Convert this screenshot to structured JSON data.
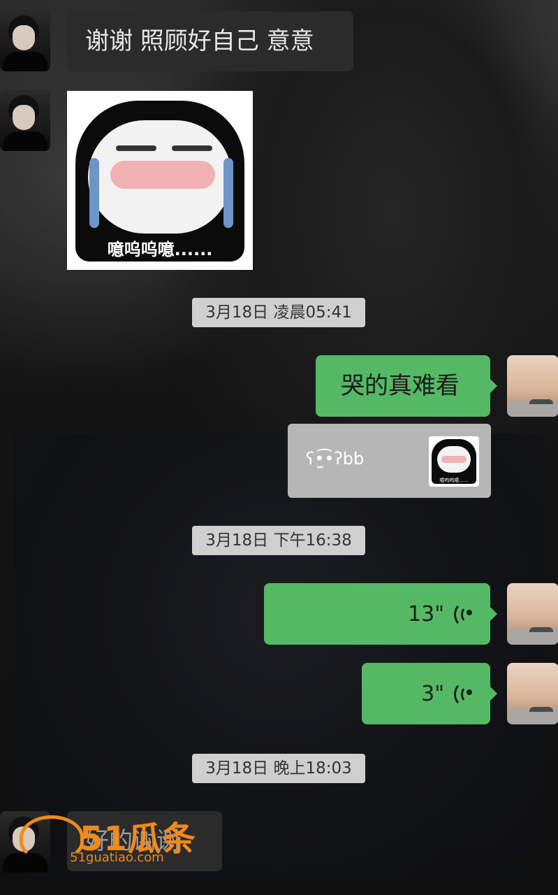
{
  "messages": {
    "m1": {
      "text": "谢谢 照顾好自己 意意"
    },
    "m2": {
      "meme_caption": "噫呜呜噫......"
    },
    "ts1": "3月18日 凌晨05:41",
    "m3": {
      "text": "哭的真难看"
    },
    "m4": {
      "quote_text": "ʕ•̫͡•ʔbb",
      "meme_caption": "噫呜呜噫......"
    },
    "ts2": "3月18日 下午16:38",
    "m5": {
      "voice_duration": "13\""
    },
    "m6": {
      "voice_duration": "3\""
    },
    "ts3": "3月18日 晚上18:03",
    "m7": {
      "text": "好的谢谢"
    }
  },
  "watermark": {
    "brand": "51瓜条",
    "site": "51guatiao.com"
  },
  "colors": {
    "outgoing_bubble": "#55b865",
    "incoming_bubble": "#2b2b2b",
    "watermark": "#f08a1a"
  }
}
